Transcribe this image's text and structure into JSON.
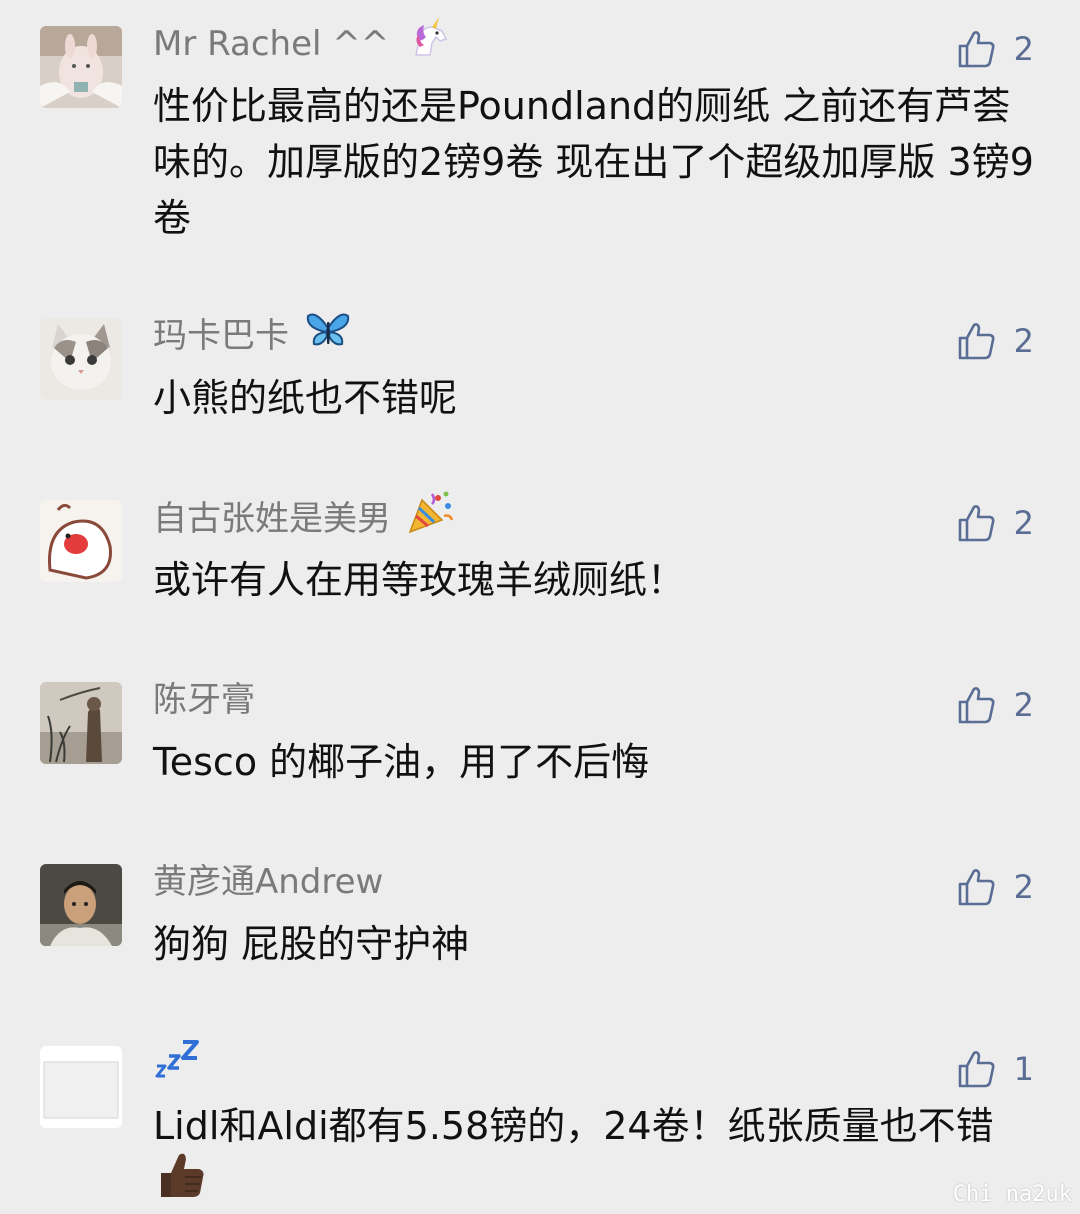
{
  "comments": [
    {
      "name": "Mr Rachel ^^",
      "emoji": "unicorn",
      "text": "性价比最高的还是Poundland的厕纸 之前还有芦荟味的。加厚版的2镑9卷 现在出了个超级加厚版 3镑9卷",
      "likes": "2"
    },
    {
      "name": "玛卡巴卡",
      "emoji": "butterfly",
      "text": "小熊的纸也不错呢",
      "likes": "2"
    },
    {
      "name": "自古张姓是美男",
      "emoji": "party-popper",
      "text": "或许有人在用等玫瑰羊绒厕纸！",
      "likes": "2"
    },
    {
      "name": "陈牙膏",
      "emoji": "",
      "text": "Tesco 的椰子油，用了不后悔",
      "likes": "2"
    },
    {
      "name": "黄彦通Andrew",
      "emoji": "",
      "text": "狗狗 屁股的守护神",
      "likes": "2"
    },
    {
      "name": "",
      "emoji": "zzz",
      "text": "Lidl和Aldi都有5.58镑的，24卷！纸张质量也不错",
      "text_emoji": "thumbs-up",
      "likes": "1"
    }
  ],
  "watermark": "Chi na2uk",
  "colors": {
    "background": "#ededed",
    "name": "#7a7a7a",
    "text": "#111111",
    "like": "#5a6d94"
  }
}
